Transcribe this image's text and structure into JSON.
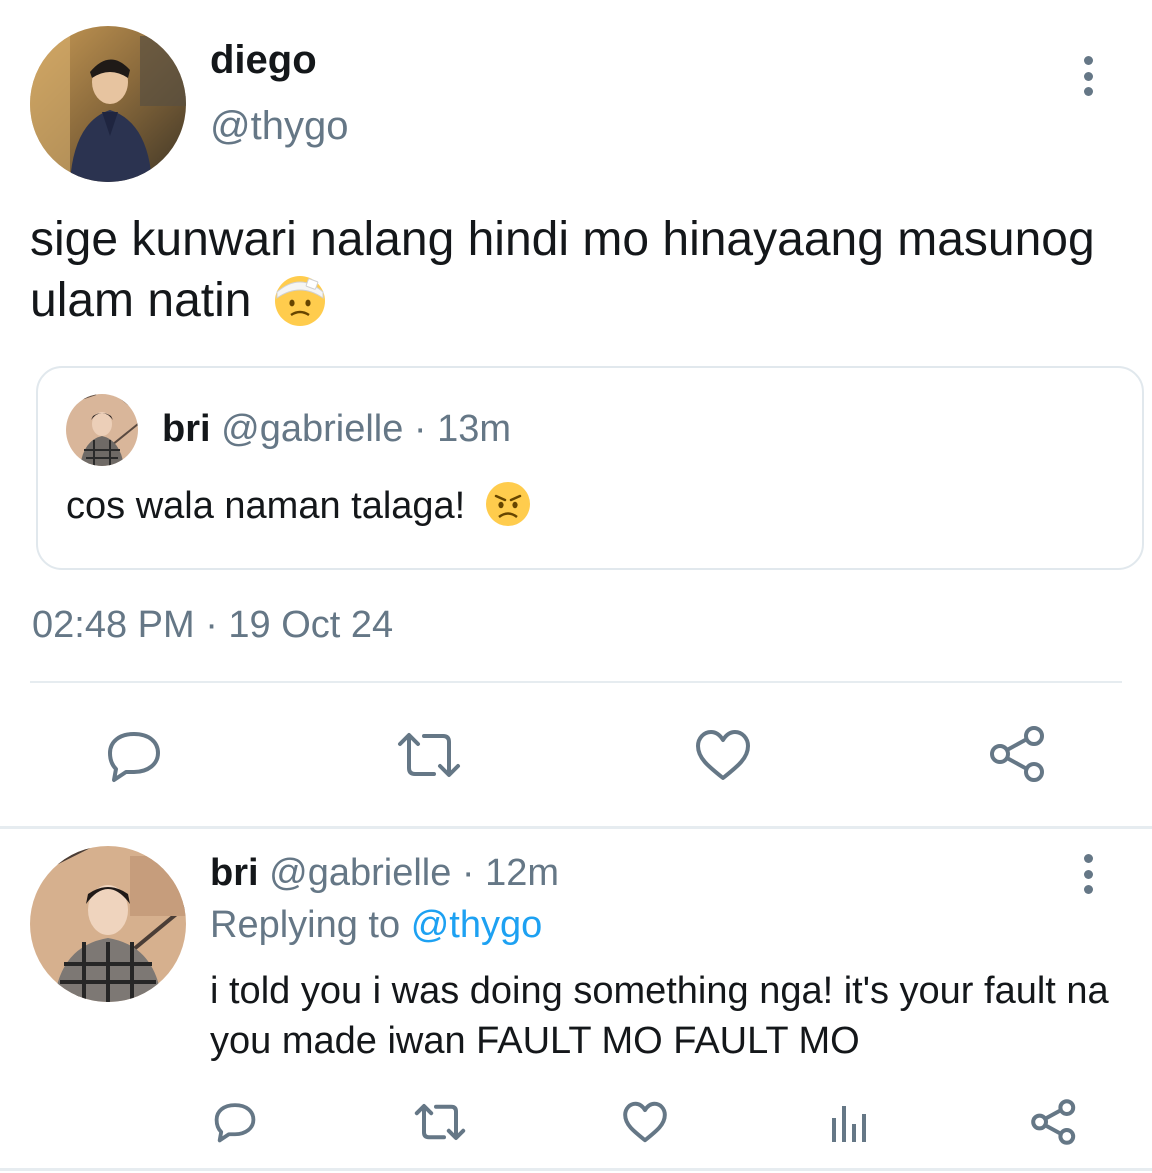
{
  "main_tweet": {
    "display_name": "diego",
    "handle": "@thygo",
    "text": "sige kunwari nalang hindi mo hinayaang masunog ulam natin",
    "text_emoji": "face-with-head-bandage-emoji",
    "quoted": {
      "display_name": "bri",
      "handle": "@gabrielle",
      "separator": " · ",
      "time": "13m",
      "text": "cos wala naman talaga!",
      "text_emoji": "angry-face-emoji"
    },
    "timestamp": "02:48 PM · 19 Oct 24",
    "actions": [
      "reply-icon",
      "retweet-icon",
      "like-icon",
      "share-icon"
    ]
  },
  "reply": {
    "display_name": "bri",
    "handle": "@gabrielle",
    "separator": " · ",
    "time": "12m",
    "replying_to_label": "Replying to",
    "replying_to_handle": "@thygo",
    "text": "i told you i was doing something nga! it's your fault na you made iwan FAULT MO FAULT MO",
    "actions": [
      "reply-icon",
      "retweet-icon",
      "like-icon",
      "analytics-icon",
      "share-icon"
    ]
  },
  "colors": {
    "text_primary": "#14171a",
    "text_secondary": "#657786",
    "link": "#1da1f2",
    "divider": "#e6ecf0",
    "border": "#e1e8ed",
    "icon": "#657786"
  }
}
